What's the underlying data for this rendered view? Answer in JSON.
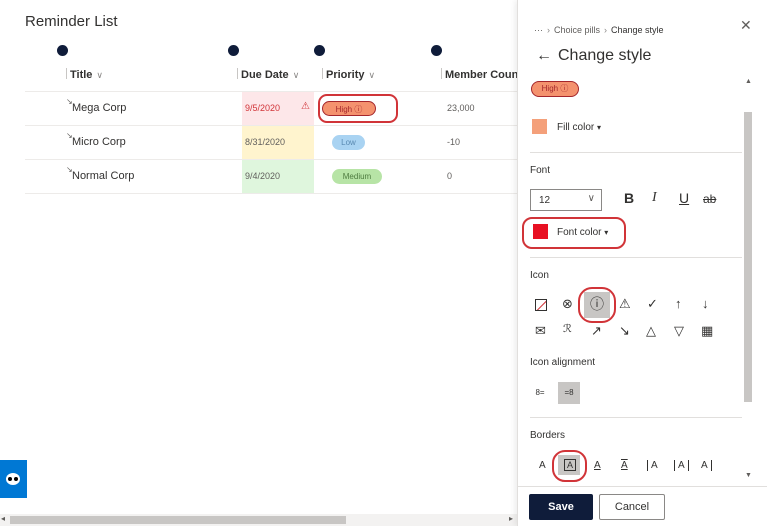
{
  "list": {
    "title": "Reminder List",
    "columns": [
      "Title",
      "Due Date",
      "Priority",
      "Member Coun"
    ],
    "rows": [
      {
        "title": "Mega Corp",
        "due": "9/5/2020",
        "priority": "High",
        "members": "23,000"
      },
      {
        "title": "Micro Corp",
        "due": "8/31/2020",
        "priority": "Low",
        "members": "-10"
      },
      {
        "title": "Normal Corp",
        "due": "9/4/2020",
        "priority": "Medium",
        "members": "0"
      }
    ]
  },
  "panel": {
    "breadcrumb": {
      "ellipsis": "···",
      "parent": "Choice pills",
      "current": "Change style"
    },
    "close_glyph": "✕",
    "title": "Change style",
    "preview_pill": "High",
    "fill_color_label": "Fill color",
    "font_section": "Font",
    "font_size": "12",
    "bold": "B",
    "italic": "I",
    "underline": "U",
    "strike": "ab",
    "font_color_label": "Font color",
    "icon_section": "Icon",
    "icon_alignment_label": "Icon alignment",
    "align_left": "8=",
    "align_right": "=8",
    "borders_section": "Borders",
    "border_glyph": "A",
    "save_label": "Save",
    "cancel_label": "Cancel"
  },
  "icons": {
    "row1": [
      "none-icon",
      "cross-circle-icon",
      "info-circle-icon",
      "warning-triangle-icon",
      "checkmark-icon",
      "arrow-up-icon",
      "arrow-down-icon"
    ],
    "row2": [
      "mail-icon",
      "people-icon",
      "trend-up-icon",
      "trend-down-icon",
      "thumbs-up-icon",
      "thumbs-down-icon",
      "calendar-icon"
    ]
  },
  "colors": {
    "high_pill": "#f4926e",
    "low_pill": "#a9d3f2",
    "medium_pill": "#b7e4a6",
    "date_red_bg": "#fde7e9",
    "date_yellow_bg": "#fff4ce",
    "date_green_bg": "#dff6dd",
    "fill_swatch": "#f4a07a",
    "font_swatch": "#e81123",
    "accent": "#0f1c3a",
    "highlight_ring": "#d13438"
  }
}
